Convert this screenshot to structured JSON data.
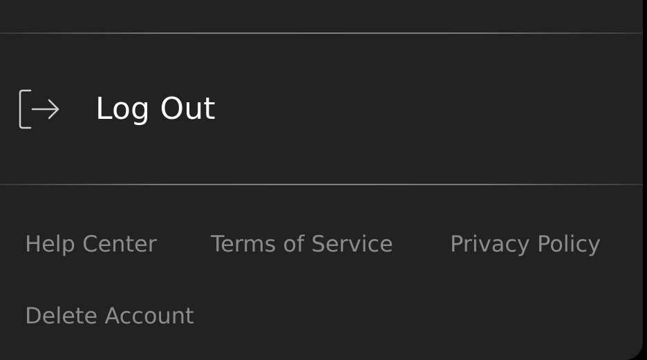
{
  "account_menu": {
    "logout": {
      "label": "Log Out",
      "icon": "logout-icon"
    },
    "footer_links": {
      "help_center": "Help Center",
      "terms_of_service": "Terms of Service",
      "privacy_policy": "Privacy Policy",
      "delete_account": "Delete Account"
    }
  },
  "colors": {
    "background": "#222222",
    "primary_text": "#ffffff",
    "secondary_text": "#8c8c90",
    "icon_stroke": "#d0d0d0"
  }
}
